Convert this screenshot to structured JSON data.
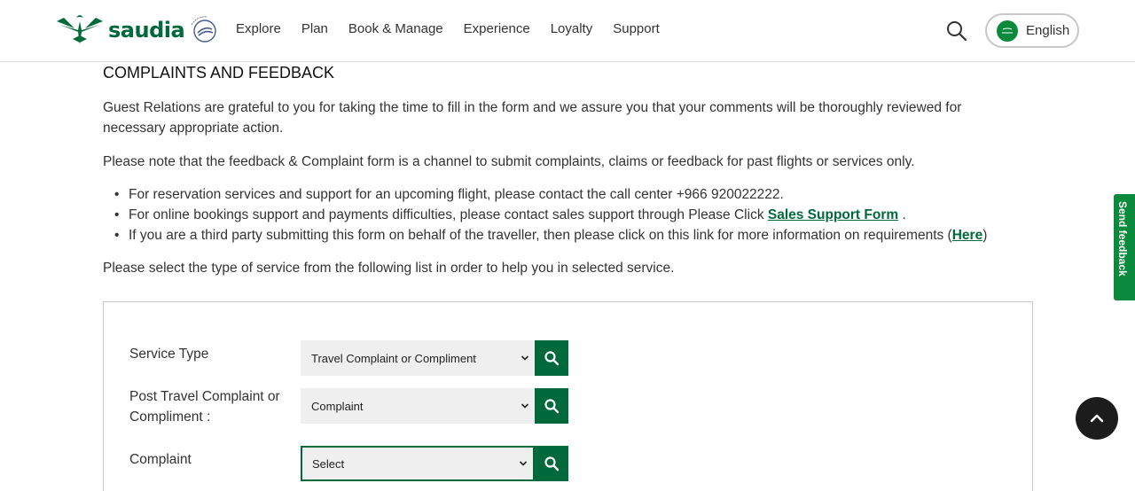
{
  "header": {
    "brand": "saudia",
    "nav": [
      "Explore",
      "Plan",
      "Book & Manage",
      "Experience",
      "Loyalty",
      "Support"
    ],
    "language": "English",
    "brand_color": "#00693c"
  },
  "main": {
    "title": "COMPLAINTS AND FEEDBACK",
    "intro": "Guest Relations are grateful to you for taking the time to fill in the form and we assure you that your comments will be thoroughly reviewed for necessary appropriate action.",
    "note": "Please note that the feedback & Complaint form is a channel to submit complaints, claims or feedback for past flights or services only.",
    "bullets": {
      "b1": "For reservation services and support for an upcoming flight, please contact the call center +966 920022222.",
      "b2_pre": "For online bookings support and payments difficulties, please contact sales support through Please Click ",
      "b2_link": "Sales Support Form",
      "b2_post": " .",
      "b3_pre": "If you are a third party submitting this form on behalf of the traveller, then please click on this link for more information on requirements (",
      "b3_link": "Here",
      "b3_post": ")"
    },
    "select_prompt": "Please select the type of service from the following list in order to help you in selected service."
  },
  "form": {
    "service_type_label": "Service Type",
    "service_type_value": "Travel Complaint or Compliment",
    "post_travel_label": "Post Travel Complaint or Compliment :",
    "post_travel_value": "Complaint",
    "complaint_label": "Complaint",
    "complaint_value": "Select"
  },
  "side": {
    "feedback_tab": "Send feedback"
  },
  "icons": {
    "search": "search-icon",
    "chevron": "chevron-down-icon",
    "scroll_top": "chevron-up-icon"
  }
}
